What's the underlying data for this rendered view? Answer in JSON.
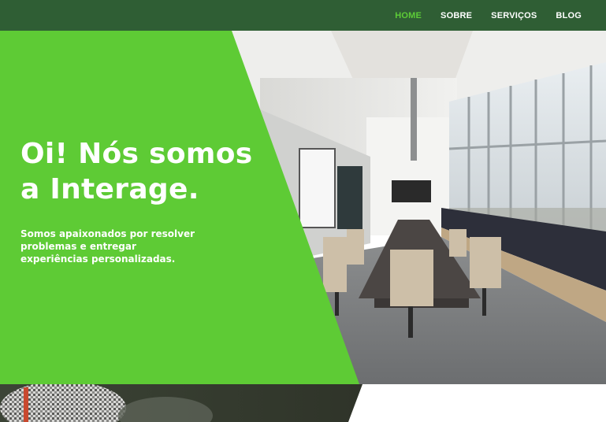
{
  "nav": {
    "items": [
      {
        "label": "HOME",
        "active": true
      },
      {
        "label": "SOBRE",
        "active": false
      },
      {
        "label": "SERVIÇOS",
        "active": false
      },
      {
        "label": "BLOG",
        "active": false
      }
    ]
  },
  "hero": {
    "title_line1": "Oi! Nós somos",
    "title_line2": "a Interage.",
    "subtitle_line1": "Somos apaixonados por resolver",
    "subtitle_line2": "problemas e entregar",
    "subtitle_line3": "experiências personalizadas."
  },
  "colors": {
    "navbar": "#2f5e34",
    "accent_green": "#5ecb35",
    "active_link": "#5dcc37",
    "text": "#ffffff"
  },
  "icons": {
    "hero_image": "conference-room-photo",
    "next_section_image": "person-photo"
  }
}
